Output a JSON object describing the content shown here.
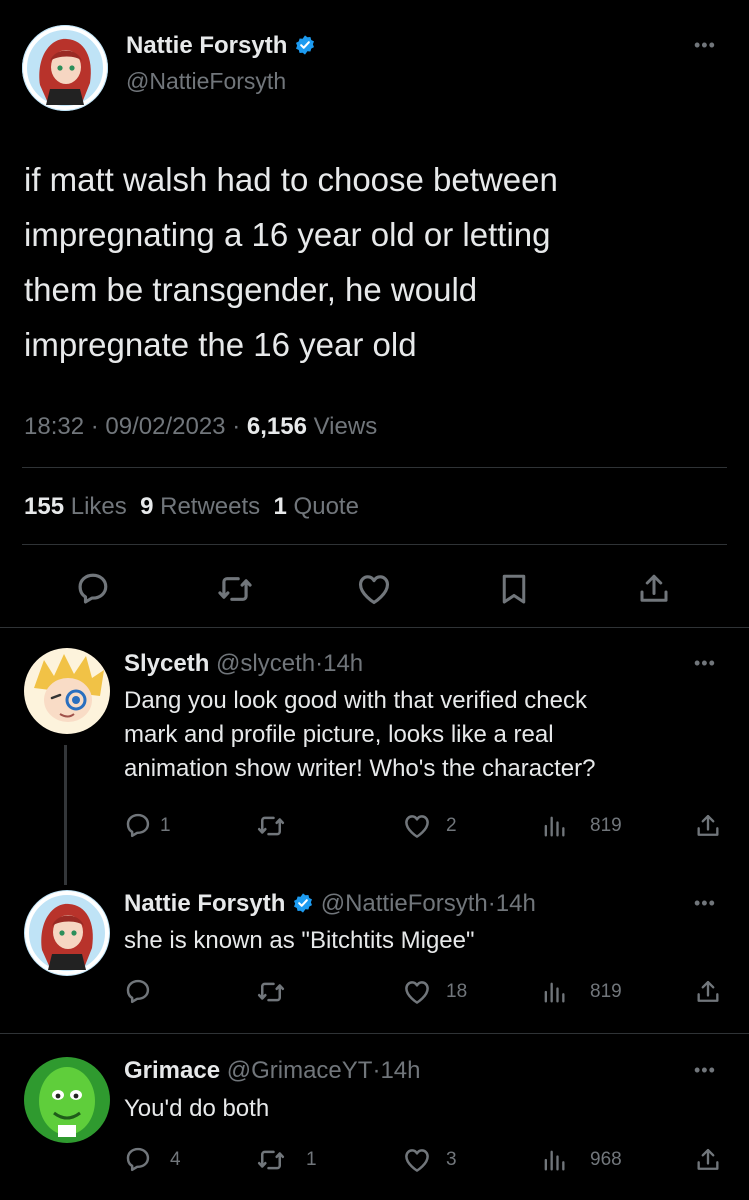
{
  "main_tweet": {
    "author_name": "Nattie Forsyth",
    "handle": "@NattieForsyth",
    "text_lines": [
      "if matt walsh had to choose between",
      "impregnating a 16 year old or letting",
      "them be transgender, he would",
      "impregnate the 16 year old"
    ],
    "time": "18:32",
    "date": "09/02/2023",
    "views_count": "6,156",
    "views_label": "Views",
    "likes_count": "155",
    "likes_label": "Likes",
    "retweets_count": "9",
    "retweets_label": "Retweets",
    "quotes_count": "1",
    "quotes_label": "Quote",
    "separator": "·"
  },
  "replies": [
    {
      "author_name": "Slyceth",
      "handle": "@slyceth",
      "time": "14h",
      "text_lines": [
        "Dang you look good with that verified check",
        "mark and profile picture, looks like a real",
        "animation show writer! Who's the character?"
      ],
      "replies_count": "1",
      "retweets_count": "",
      "likes_count": "2",
      "views_count": "819"
    },
    {
      "author_name": "Nattie Forsyth",
      "handle": "@NattieForsyth",
      "time": "14h",
      "text_lines": [
        "she is known as \"Bitchtits Migee\""
      ],
      "replies_count": "",
      "retweets_count": "",
      "likes_count": "18",
      "views_count": "819"
    },
    {
      "author_name": "Grimace",
      "handle": "@GrimaceYT",
      "time": "14h",
      "text_lines": [
        "You'd do both"
      ],
      "replies_count": "4",
      "retweets_count": "1",
      "likes_count": "3",
      "views_count": "968"
    }
  ],
  "icons": {
    "reply": "reply-icon",
    "retweet": "retweet-icon",
    "like": "heart-icon",
    "bookmark": "bookmark-icon",
    "share": "share-icon",
    "views": "views-icon",
    "verified": "verified-badge-icon",
    "more": "more-icon"
  },
  "colors": {
    "background": "#000000",
    "text": "#e7e9ea",
    "muted": "#71767b",
    "verified": "#1d9bf0",
    "divider": "#2f3336"
  }
}
